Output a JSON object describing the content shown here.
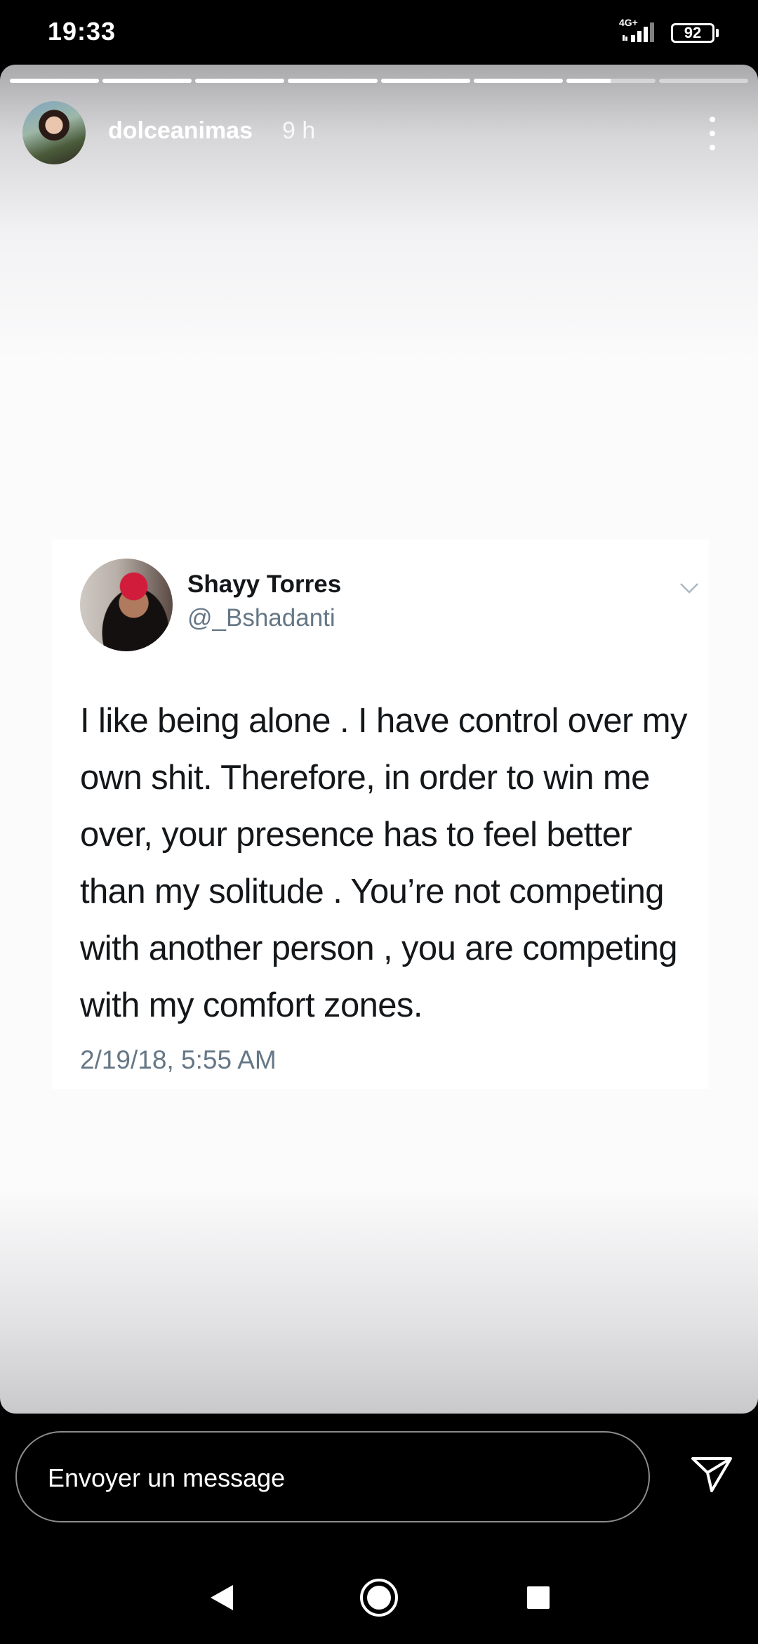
{
  "status_bar": {
    "time": "19:33",
    "network": "4G+",
    "battery": "92"
  },
  "story": {
    "progress": {
      "segments": [
        1,
        1,
        1,
        1,
        1,
        1,
        0.5,
        0
      ],
      "active_color": "#ffffff"
    },
    "username": "dolceanimas",
    "time_ago": "9 h",
    "more_icon": "more-vertical-icon"
  },
  "tweet": {
    "name": "Shayy Torres",
    "handle": "@_Bshadanti",
    "text": "I like being alone . I have control over my own shit. Therefore, in order to win me over,  your presence has to feel better than my solitude . You’re not competing with another person , you are competing with my comfort zones.",
    "date": "2/19/18, 5:55 AM",
    "chevron_icon": "chevron-down-icon"
  },
  "reply": {
    "placeholder": "Envoyer un message",
    "send_icon": "send-icon"
  },
  "nav": {
    "back_icon": "back-icon",
    "home_icon": "home-icon",
    "recents_icon": "recents-icon"
  }
}
